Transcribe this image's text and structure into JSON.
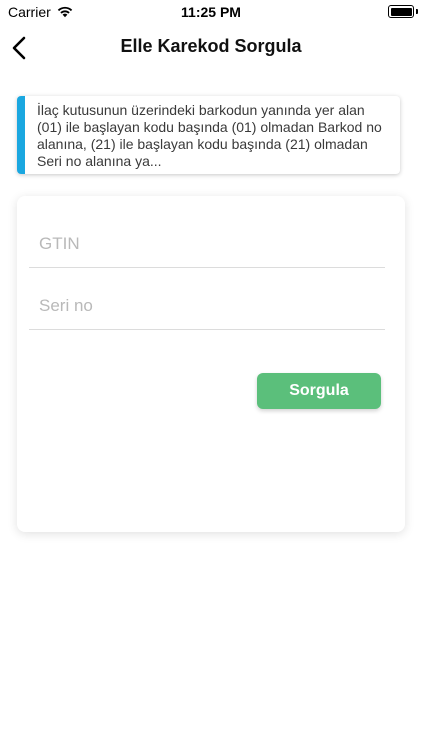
{
  "status_bar": {
    "carrier": "Carrier",
    "time": "11:25 PM"
  },
  "nav": {
    "title": "Elle Karekod Sorgula",
    "back_icon": "chevron-left-icon"
  },
  "info": {
    "text": "İlaç kutusunun üzerindeki barkodun yanında yer alan (01) ile başlayan kodu başında (01) olmadan Barkod no alanına, (21) ile başlayan kodu başında (21) olmadan Seri no alanına ya...",
    "accent_color": "#1aa7e0"
  },
  "form": {
    "gtin": {
      "value": "",
      "placeholder": "GTIN"
    },
    "seri": {
      "value": "",
      "placeholder": "Seri no"
    },
    "submit_label": "Sorgula",
    "submit_color": "#5bbf7b"
  }
}
